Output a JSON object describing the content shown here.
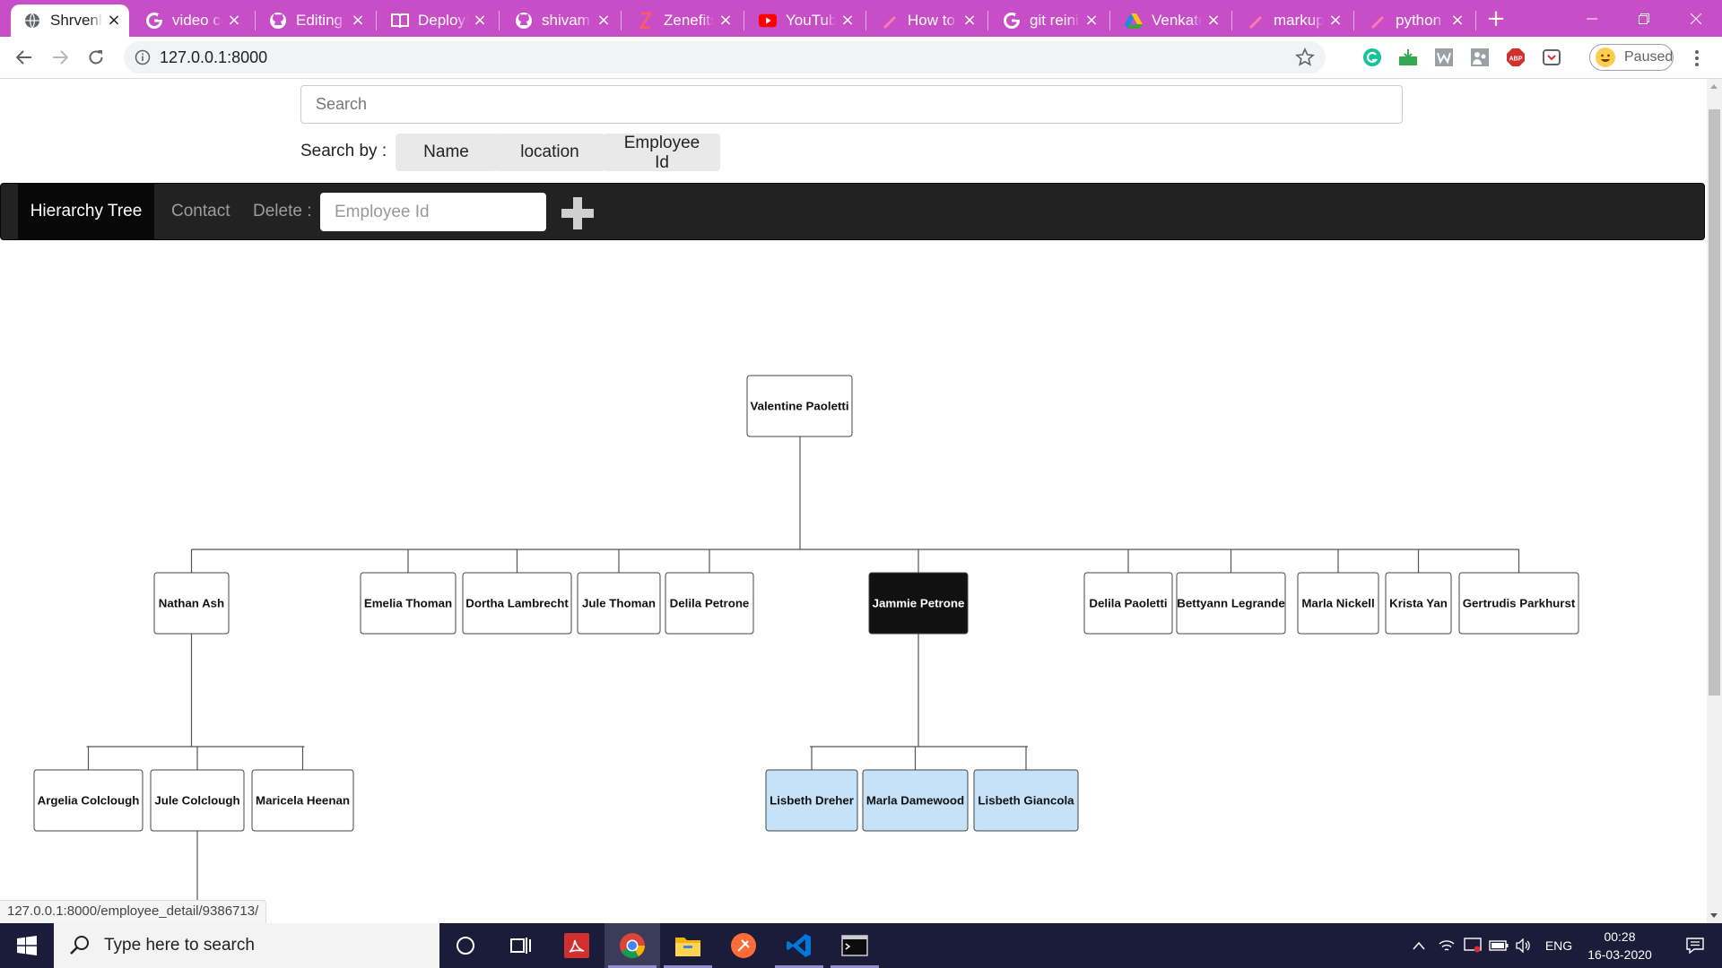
{
  "browser": {
    "tabs": [
      {
        "title": "Shrvenk",
        "icon": "globe-icon",
        "active": true
      },
      {
        "title": "video co",
        "icon": "google-icon"
      },
      {
        "title": "Editing r",
        "icon": "github-icon"
      },
      {
        "title": "Deploy!",
        "icon": "book-icon"
      },
      {
        "title": "shivam-",
        "icon": "github-icon"
      },
      {
        "title": "Zenefits",
        "icon": "zenefits-icon"
      },
      {
        "title": "YouTube",
        "icon": "youtube-icon"
      },
      {
        "title": "How to",
        "icon": "app-icon"
      },
      {
        "title": "git reini",
        "icon": "google-icon"
      },
      {
        "title": "Venkate",
        "icon": "drive-icon"
      },
      {
        "title": "markup",
        "icon": "app-icon"
      },
      {
        "title": "python",
        "icon": "app-icon"
      }
    ],
    "url": "127.0.0.1:8000",
    "profile_status": "Paused",
    "status_url": "127.0.0.1:8000/employee_detail/9386713/"
  },
  "search": {
    "placeholder": "Search"
  },
  "search_by": {
    "label": "Search by :",
    "options": [
      "Name",
      "location",
      "Employee Id"
    ]
  },
  "navbar": {
    "hierarchy_tree": "Hierarchy Tree",
    "contact": "Contact",
    "delete_label": "Delete :",
    "employee_id_placeholder": "Employee Id"
  },
  "hierarchy": {
    "name": "Valentine Paoletti",
    "children": [
      {
        "name": "Nathan Ash",
        "children": [
          {
            "name": "Argelia Colclough"
          },
          {
            "name": "Jule Colclough",
            "has_children": true
          },
          {
            "name": "Maricela Heenan"
          }
        ]
      },
      {
        "name": "Emelia Thoman"
      },
      {
        "name": "Dortha Lambrecht"
      },
      {
        "name": "Jule Thoman"
      },
      {
        "name": "Delila Petrone"
      },
      {
        "name": "Jammie Petrone",
        "selected": true,
        "children": [
          {
            "name": "Lisbeth Dreher",
            "highlighted": true
          },
          {
            "name": "Marla Damewood",
            "highlighted": true
          },
          {
            "name": "Lisbeth Giancola",
            "highlighted": true
          }
        ]
      },
      {
        "name": "Delila Paoletti"
      },
      {
        "name": "Bettyann Legrande"
      },
      {
        "name": "Marla Nickell"
      },
      {
        "name": "Krista Yan"
      },
      {
        "name": "Gertrudis Parkhurst"
      }
    ]
  },
  "colors": {
    "node_border": "#444444",
    "selected_fill": "#111111",
    "highlight_fill": "#c6e2f8",
    "connector": "#555555"
  },
  "taskbar": {
    "search_placeholder": "Type here to search",
    "apps": [
      "cortana-icon",
      "task-view-icon",
      "acrobat-icon",
      "chrome-icon",
      "file-explorer-icon",
      "postman-icon",
      "vscode-icon",
      "terminal-icon"
    ],
    "language": "ENG",
    "time": "00:28",
    "date": "16-03-2020"
  }
}
